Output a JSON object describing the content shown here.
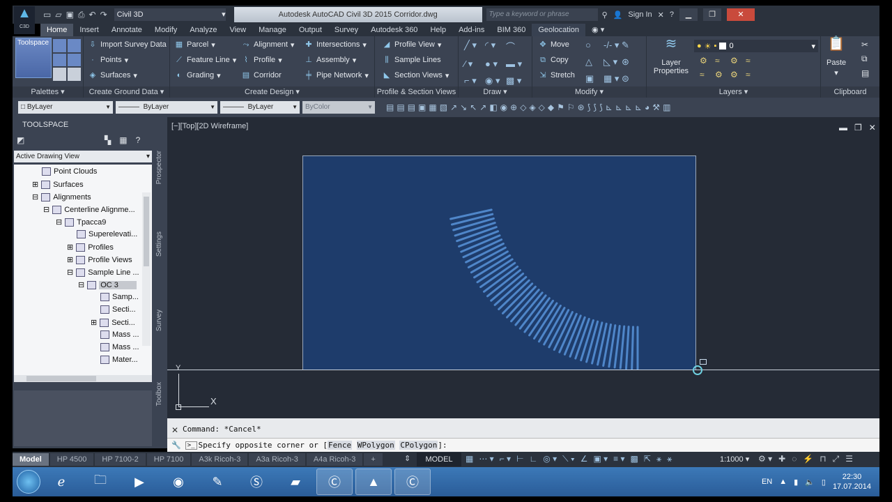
{
  "app": {
    "workspace": "Civil 3D",
    "title": "Autodesk AutoCAD Civil 3D 2015   Corridor.dwg",
    "search_placeholder": "Type a keyword or phrase",
    "sign_in": "Sign In",
    "logo_text": "C3D"
  },
  "menu_tabs": [
    "Home",
    "Insert",
    "Annotate",
    "Modify",
    "Analyze",
    "View",
    "Manage",
    "Output",
    "Survey",
    "Autodesk 360",
    "Help",
    "Add-ins",
    "BIM 360",
    "Geolocation"
  ],
  "ribbon": {
    "toolspace_btn": "Toolspace",
    "palettes": {
      "title": "Palettes"
    },
    "create_ground": {
      "title": "Create Ground Data",
      "items": [
        "Import Survey Data",
        "Points",
        "Surfaces"
      ]
    },
    "create_design": {
      "title": "Create Design",
      "items": [
        "Parcel",
        "Feature Line",
        "Grading",
        "Alignment",
        "Profile",
        "Corridor",
        "Intersections",
        "Assembly",
        "Pipe Network"
      ]
    },
    "profile_section": {
      "title": "Profile & Section Views",
      "items": [
        "Profile View",
        "Sample Lines",
        "Section Views"
      ]
    },
    "draw": {
      "title": "Draw"
    },
    "modify": {
      "title": "Modify",
      "items": [
        "Move",
        "Copy",
        "Stretch"
      ]
    },
    "layers": {
      "title": "Layers",
      "layer_properties": "Layer Properties",
      "current_layer": "0"
    },
    "clipboard": {
      "title": "Clipboard",
      "paste": "Paste"
    }
  },
  "properties": {
    "color": "ByLayer",
    "linetype": "ByLayer",
    "lineweight": "ByLayer",
    "plotstyle": "ByColor"
  },
  "toolspace": {
    "header": "TOOLSPACE",
    "view": "Active Drawing View",
    "side_tabs": [
      "Prospector",
      "Settings",
      "Survey",
      "Toolbox"
    ],
    "tree": [
      {
        "label": "Point Clouds",
        "depth": 1
      },
      {
        "label": "Surfaces",
        "depth": 1
      },
      {
        "label": "Alignments",
        "depth": 1
      },
      {
        "label": "Centerline Alignme...",
        "depth": 2
      },
      {
        "label": "Tpacca9",
        "depth": 3
      },
      {
        "label": "Superelevati...",
        "depth": 4
      },
      {
        "label": "Profiles",
        "depth": 4
      },
      {
        "label": "Profile Views",
        "depth": 4
      },
      {
        "label": "Sample Line ...",
        "depth": 4
      },
      {
        "label": "OC 3",
        "depth": 5
      },
      {
        "label": "Samp...",
        "depth": 6
      },
      {
        "label": "Secti...",
        "depth": 6
      },
      {
        "label": "Secti...",
        "depth": 6
      },
      {
        "label": "Mass ...",
        "depth": 6
      },
      {
        "label": "Mass ...",
        "depth": 6
      },
      {
        "label": "Mater...",
        "depth": 6
      }
    ]
  },
  "viewport": {
    "label": "[−][Top][2D Wireframe]"
  },
  "command": {
    "history": "Command: *Cancel*",
    "prompt": "Specify opposite corner or [",
    "options": [
      "Fence",
      "WPolygon",
      "CPolygon"
    ],
    "suffix": "]:"
  },
  "layout_tabs": [
    "Model",
    "HP 4500",
    "HP 7100-2",
    "HP 7100",
    "A3k Ricoh-3",
    "A3a Ricoh-3",
    "A4a Ricoh-3"
  ],
  "status": {
    "model": "MODEL",
    "scale": "1:1000"
  },
  "taskbar": {
    "language": "EN",
    "time": "22:30",
    "date": "17.07.2014"
  }
}
